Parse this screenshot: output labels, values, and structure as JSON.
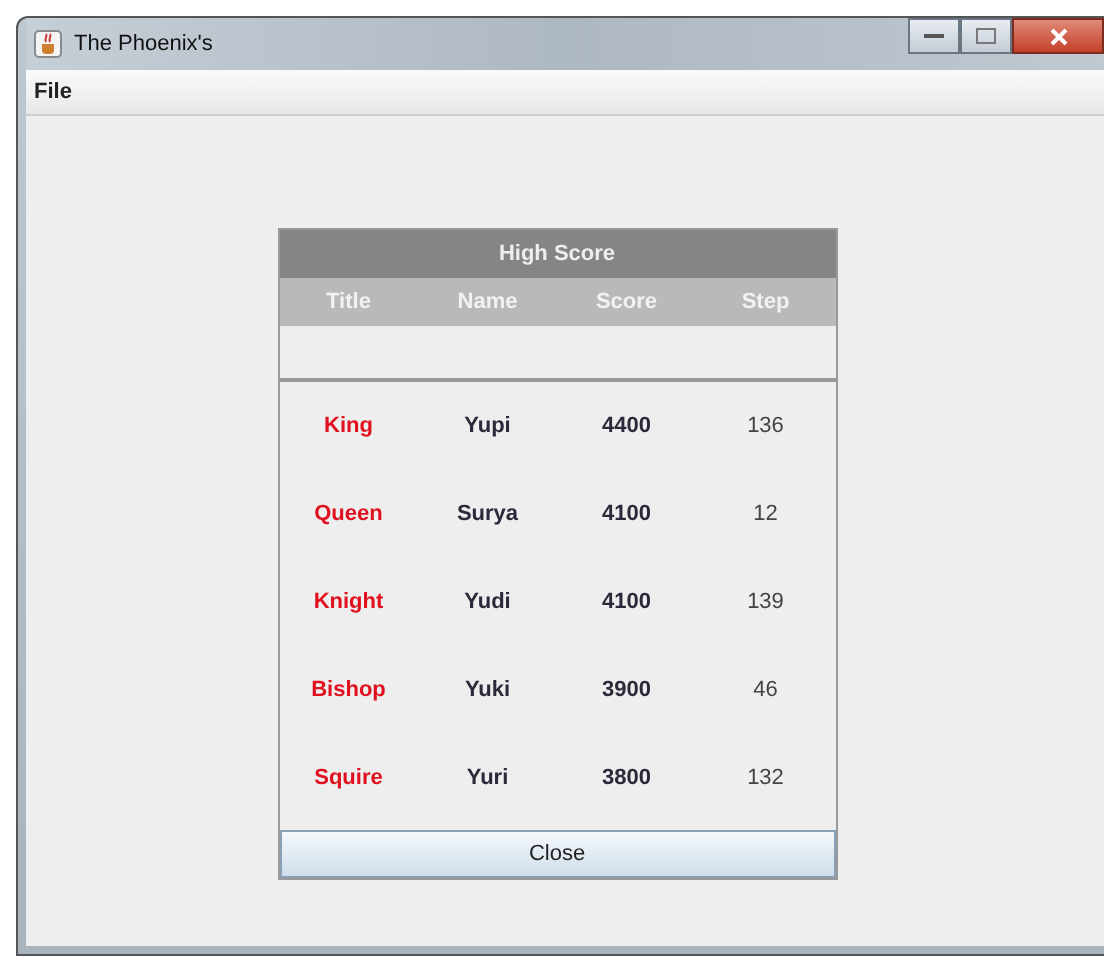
{
  "window": {
    "title": "The Phoenix's"
  },
  "menu": [
    "File"
  ],
  "high_score": {
    "title": "High Score",
    "columns": [
      "Title",
      "Name",
      "Score",
      "Step"
    ],
    "rows": [
      {
        "title": "King",
        "name": "Yupi",
        "score": "4400",
        "step": "136"
      },
      {
        "title": "Queen",
        "name": "Surya",
        "score": "4100",
        "step": "12"
      },
      {
        "title": "Knight",
        "name": "Yudi",
        "score": "4100",
        "step": "139"
      },
      {
        "title": "Bishop",
        "name": "Yuki",
        "score": "3900",
        "step": "46"
      },
      {
        "title": "Squire",
        "name": "Yuri",
        "score": "3800",
        "step": "132"
      }
    ],
    "close_button": "Close"
  }
}
